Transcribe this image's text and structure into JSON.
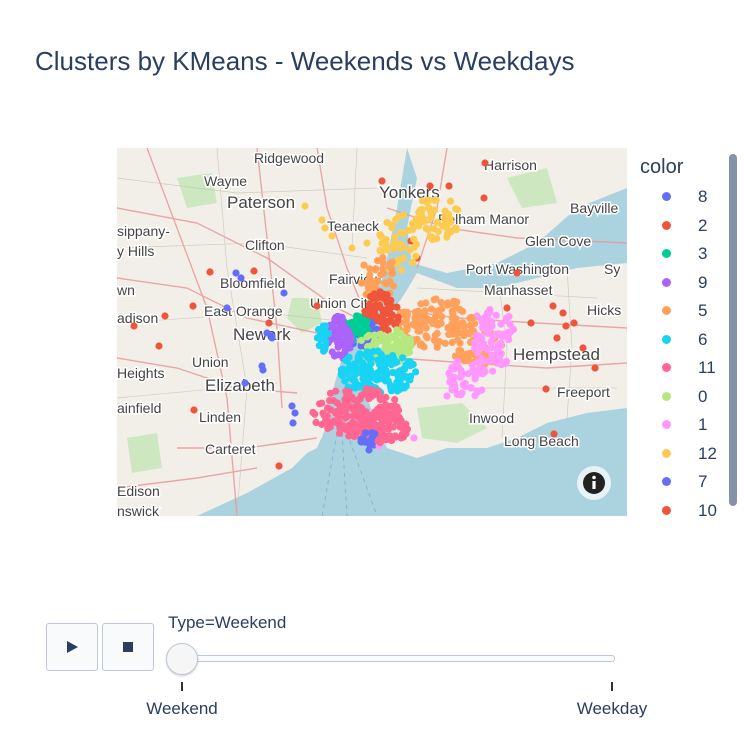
{
  "chart_data": {
    "type": "scatter_mapbox",
    "title": "Clusters by KMeans - Weekends vs Weekdays",
    "legend_title": "color",
    "legend_placement": "right",
    "series": [
      {
        "name": "8",
        "color": "#636efa"
      },
      {
        "name": "2",
        "color": "#ef553b"
      },
      {
        "name": "3",
        "color": "#00cc96"
      },
      {
        "name": "9",
        "color": "#ab63fa"
      },
      {
        "name": "5",
        "color": "#ffa15a"
      },
      {
        "name": "6",
        "color": "#19d3f3"
      },
      {
        "name": "11",
        "color": "#ff6692"
      },
      {
        "name": "0",
        "color": "#b6e880"
      },
      {
        "name": "1",
        "color": "#ff97ff"
      },
      {
        "name": "12",
        "color": "#fecb52"
      },
      {
        "name": "7",
        "color": "#636efa"
      },
      {
        "name": "10",
        "color": "#ef553b"
      }
    ],
    "map_place_labels": [
      "Ridgewood",
      "Harrison",
      "Wayne",
      "Yonkers",
      "Paterson",
      "Bayville",
      "Teaneck",
      "Pelham Manor",
      "sippany-",
      "Glen Cove",
      "y Hills",
      "Clifton",
      "Port Washington",
      "Sy",
      "Bloomfield",
      "Fairview",
      "wn",
      "Manhasset",
      "Hicks",
      "East Orange",
      "Union City",
      "adison",
      "Newark",
      "Hempstead",
      "Union",
      "Heights",
      "Elizabeth",
      "Freeport",
      "ainfield",
      "Linden",
      "Inwood",
      "Long Beach",
      "Carteret",
      "Edison",
      "nswick"
    ],
    "animation": {
      "frame_label_prefix": "Type=",
      "current_frame": "Weekend",
      "frames": [
        "Weekend",
        "Weekday"
      ],
      "current_index": 0
    }
  },
  "controls": {
    "play_icon": "play-icon",
    "stop_icon": "stop-icon",
    "info_icon": "info-icon"
  }
}
